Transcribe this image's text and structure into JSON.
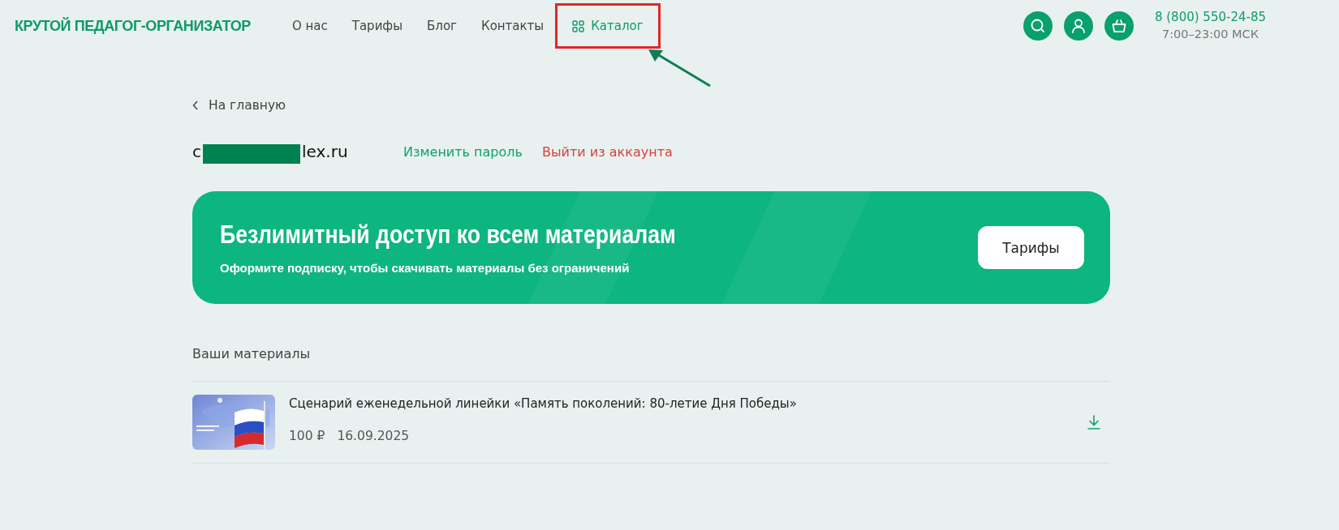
{
  "header": {
    "logo": "КРУТОЙ ПЕДАГОГ-ОРГАНИЗАТОР",
    "nav": [
      {
        "label": "О нас",
        "kind": "link",
        "highlighted": false
      },
      {
        "label": "Тарифы",
        "kind": "link",
        "highlighted": false
      },
      {
        "label": "Блог",
        "kind": "link",
        "highlighted": false
      },
      {
        "label": "Контакты",
        "kind": "link",
        "highlighted": false
      },
      {
        "label": "Каталог",
        "kind": "catalog",
        "highlighted": true
      }
    ],
    "phone": "8 (800) 550-24-85",
    "hours": "7:00–23:00 МСК"
  },
  "back_link": "На главную",
  "account": {
    "email_parts": [
      "c",
      "lex.ru"
    ],
    "redacted": true,
    "change_password": "Изменить пароль",
    "logout": "Выйти из аккаунта"
  },
  "banner": {
    "title": "Безлимитный доступ ко всем материалам",
    "subtitle": "Оформите подписку, чтобы скачивать материалы без ограничений",
    "button": "Тарифы"
  },
  "materials": {
    "heading": "Ваши материалы",
    "items": [
      {
        "title": "Сценарий еженедельной линейки «Память поколений: 80-летие Дня Победы»",
        "price": "100 ₽",
        "date": "16.09.2025"
      }
    ]
  }
}
